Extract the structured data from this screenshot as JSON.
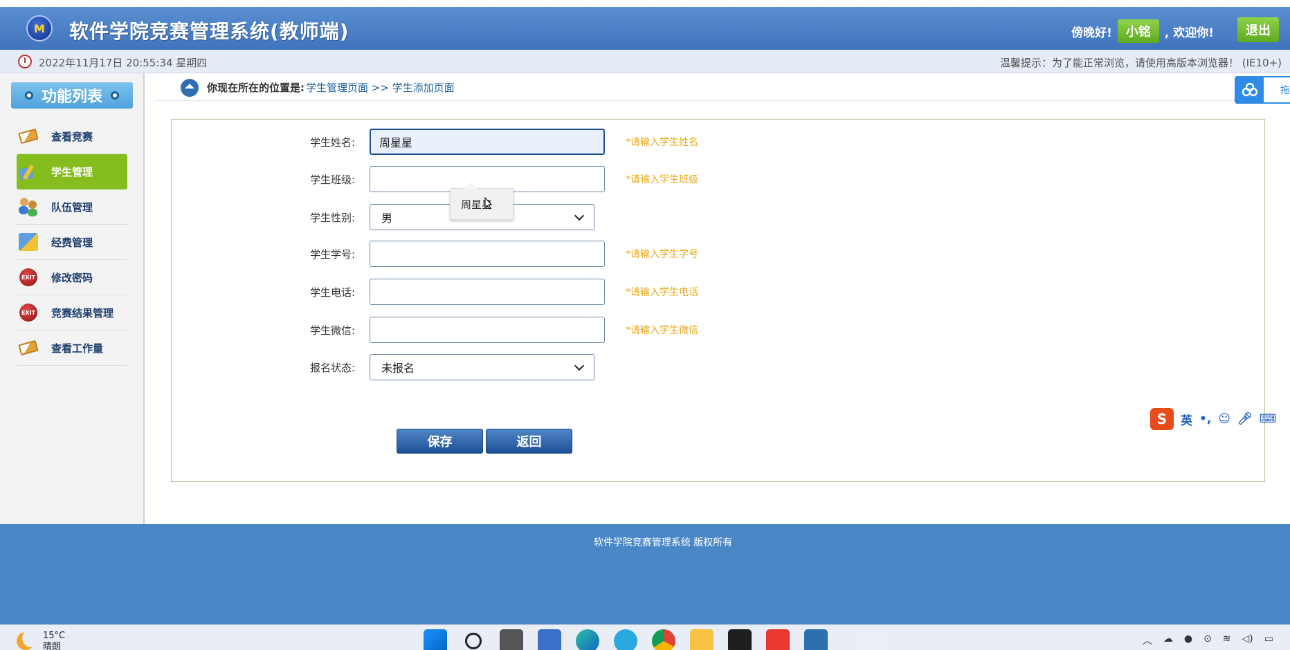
{
  "header": {
    "logo_text": "M",
    "title": "软件学院竞赛管理系统(教师端)",
    "greeting_prefix": "傍晚好!",
    "username": "小铭",
    "greeting_suffix": ", 欢迎你!",
    "logout_label": "退出"
  },
  "infobar": {
    "datetime": "2022年11月17日 20:55:34 星期四",
    "tip": "温馨提示：为了能正常浏览，请使用高版本浏览器！ (IE10+)"
  },
  "sidebar": {
    "title": "功能列表",
    "items": [
      {
        "label": "查看竞赛",
        "icon": "book-icon"
      },
      {
        "label": "学生管理",
        "icon": "student-icon",
        "active": true
      },
      {
        "label": "队伍管理",
        "icon": "team-icon"
      },
      {
        "label": "经费管理",
        "icon": "finance-icon"
      },
      {
        "label": "修改密码",
        "icon": "exit-icon"
      },
      {
        "label": "竞赛结果管理",
        "icon": "exit-icon"
      },
      {
        "label": "查看工作量",
        "icon": "book-icon"
      }
    ]
  },
  "breadcrumb": {
    "label": "你现在所在的位置是:",
    "path": "学生管理页面 >> 学生添加页面"
  },
  "side_widget": {
    "text": "拖"
  },
  "form": {
    "name": {
      "label": "学生姓名:",
      "value": "周星星",
      "hint": "*请输入学生姓名"
    },
    "class": {
      "label": "学生班级:",
      "value": "",
      "hint": "*请输入学生班级"
    },
    "gender": {
      "label": "学生性别:",
      "selected": "男"
    },
    "student_id": {
      "label": "学生学号:",
      "value": "",
      "hint": "*请输入学生学号"
    },
    "phone": {
      "label": "学生电话:",
      "value": "",
      "hint": "*请输入学生电话"
    },
    "wechat": {
      "label": "学生微信:",
      "value": "",
      "hint": "*请输入学生微信"
    },
    "status": {
      "label": "报名状态:",
      "selected": "未报名"
    },
    "autocomplete_suggestion": "周星星",
    "save_label": "保存",
    "back_label": "返回"
  },
  "ime": {
    "logo": "S",
    "lang": "英",
    "punct": "•,",
    "icons": [
      "emoji-icon",
      "mic-icon",
      "keyboard-icon",
      "user-icon"
    ]
  },
  "footer": {
    "text": "软件学院竞赛管理系统 版权所有"
  },
  "taskbar": {
    "temperature": "15°C",
    "weather": "晴朗"
  },
  "colors": {
    "header": "#4a80c6",
    "active_menu": "#85bd1e",
    "hint": "#e7a81a",
    "footer": "#4a87c6"
  }
}
